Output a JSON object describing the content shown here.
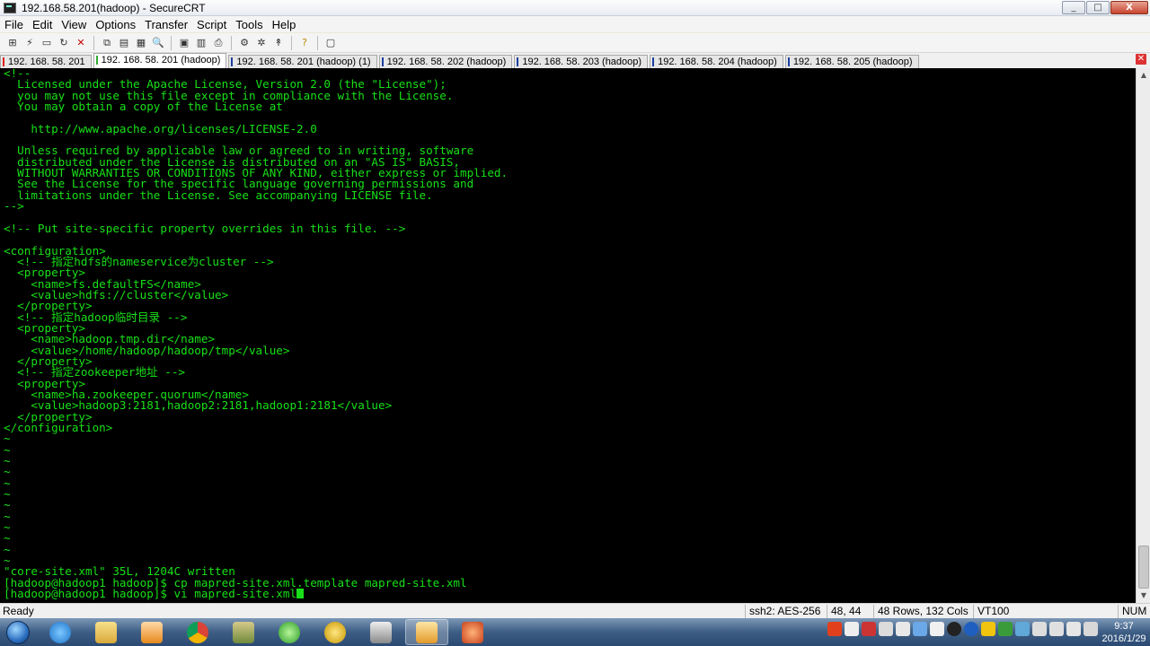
{
  "window": {
    "title": "192.168.58.201(hadoop) - SecureCRT",
    "controls": [
      "_",
      "□",
      "X"
    ]
  },
  "menu": [
    "File",
    "Edit",
    "View",
    "Options",
    "Transfer",
    "Script",
    "Tools",
    "Help"
  ],
  "toolbar": {
    "icons": [
      "connect-icon",
      "quick-connect-icon",
      "connect-tab-icon",
      "reconnect-icon",
      "disconnect-icon",
      "copy-icon",
      "paste-icon",
      "copy-paste-icon",
      "find-icon",
      "print-setup-icon",
      "print-selection-icon",
      "print-icon",
      "session-options-icon",
      "global-options-icon",
      "keymap-icon",
      "help-icon",
      "about-icon"
    ]
  },
  "tabs": [
    {
      "label": "192. 168. 58. 201",
      "state": "red"
    },
    {
      "label": "192. 168. 58. 201 (hadoop)",
      "state": "active"
    },
    {
      "label": "192. 168. 58. 201 (hadoop)  (1)",
      "state": "normal"
    },
    {
      "label": "192. 168. 58. 202 (hadoop)",
      "state": "normal"
    },
    {
      "label": "192. 168. 58. 203 (hadoop)",
      "state": "normal"
    },
    {
      "label": "192. 168. 58. 204 (hadoop)",
      "state": "normal"
    },
    {
      "label": "192. 168. 58. 205 (hadoop)",
      "state": "normal"
    }
  ],
  "terminal": {
    "lines": [
      "<!--",
      "  Licensed under the Apache License, Version 2.0 (the \"License\");",
      "  you may not use this file except in compliance with the License.",
      "  You may obtain a copy of the License at",
      "",
      "    http://www.apache.org/licenses/LICENSE-2.0",
      "",
      "  Unless required by applicable law or agreed to in writing, software",
      "  distributed under the License is distributed on an \"AS IS\" BASIS,",
      "  WITHOUT WARRANTIES OR CONDITIONS OF ANY KIND, either express or implied.",
      "  See the License for the specific language governing permissions and",
      "  limitations under the License. See accompanying LICENSE file.",
      "-->",
      "",
      "<!-- Put site-specific property overrides in this file. -->",
      "",
      "<configuration>",
      "  <!-- 指定hdfs的nameservice为cluster -->",
      "  <property>",
      "    <name>fs.defaultFS</name>",
      "    <value>hdfs://cluster</value>",
      "  </property>",
      "  <!-- 指定hadoop临时目录 -->",
      "  <property>",
      "    <name>hadoop.tmp.dir</name>",
      "    <value>/home/hadoop/hadoop/tmp</value>",
      "  </property>",
      "  <!-- 指定zookeeper地址 -->",
      "  <property>",
      "    <name>ha.zookeeper.quorum</name>",
      "    <value>hadoop3:2181,hadoop2:2181,hadoop1:2181</value>",
      "  </property>",
      "</configuration>",
      "~",
      "~",
      "~",
      "~",
      "~",
      "~",
      "~",
      "~",
      "~",
      "~",
      "~",
      "~",
      "\"core-site.xml\" 35L, 1204C written",
      "[hadoop@hadoop1 hadoop]$ cp mapred-site.xml.template mapred-site.xml",
      "[hadoop@hadoop1 hadoop]$ vi mapred-site.xml"
    ]
  },
  "status": {
    "ready": "Ready",
    "cipher": "ssh2: AES-256",
    "position": "48,  44",
    "size": "48 Rows, 132 Cols",
    "terminal_type": "VT100",
    "num": "NUM"
  },
  "taskbar": {
    "apps": [
      "start-button",
      "internet-explorer-icon",
      "file-explorer-icon",
      "media-player-icon",
      "chrome-icon",
      "network-icon",
      "refresh-tool-icon",
      "editor-icon",
      "printer-app-icon",
      "securecrt-icon",
      "game-icon"
    ],
    "time": "9:37",
    "date": "2016/1/29"
  }
}
